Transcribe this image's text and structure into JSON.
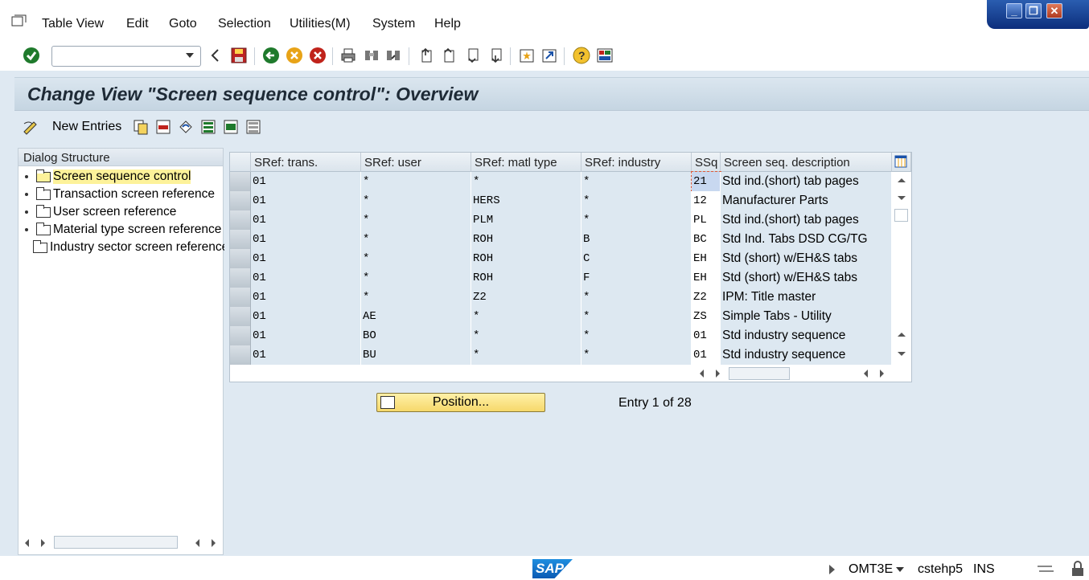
{
  "menubar": {
    "items": [
      "Table View",
      "Edit",
      "Goto",
      "Selection",
      "Utilities(M)",
      "System",
      "Help"
    ]
  },
  "toolbar": {
    "command_field_value": "",
    "icons": [
      "enter-icon",
      "back-arrow-icon",
      "save-icon",
      "back-icon",
      "exit-icon",
      "cancel-icon",
      "print-icon",
      "find-icon",
      "find-next-icon",
      "first-page-icon",
      "previous-page-icon",
      "next-page-icon",
      "last-page-icon",
      "create-session-icon",
      "shortcut-icon",
      "help-icon",
      "customize-layout-icon"
    ]
  },
  "title": "Change View \"Screen sequence control\": Overview",
  "app_toolbar": {
    "new_entries_label": "New Entries"
  },
  "dialog_structure": {
    "header": "Dialog Structure",
    "items": [
      {
        "label": "Screen sequence control",
        "selected": true
      },
      {
        "label": "Transaction screen reference",
        "selected": false
      },
      {
        "label": "User screen reference",
        "selected": false
      },
      {
        "label": "Material type screen reference",
        "selected": false
      },
      {
        "label": "Industry sector screen reference",
        "selected": false
      }
    ]
  },
  "table": {
    "columns": [
      "SRef: trans.",
      "SRef: user",
      "SRef: matl type",
      "SRef: industry",
      "SSq",
      "Screen seq. description"
    ],
    "rows": [
      [
        "01",
        "*",
        "*",
        "*",
        "21",
        "Std ind.(short) tab pages"
      ],
      [
        "01",
        "*",
        "HERS",
        "*",
        "12",
        "Manufacturer Parts"
      ],
      [
        "01",
        "*",
        "PLM",
        "*",
        "PL",
        "Std ind.(short) tab pages"
      ],
      [
        "01",
        "*",
        "ROH",
        "B",
        "BC",
        "Std Ind. Tabs DSD CG/TG"
      ],
      [
        "01",
        "*",
        "ROH",
        "C",
        "EH",
        "Std (short) w/EH&S tabs"
      ],
      [
        "01",
        "*",
        "ROH",
        "F",
        "EH",
        "Std (short) w/EH&S tabs"
      ],
      [
        "01",
        "*",
        "Z2",
        "*",
        "Z2",
        "IPM: Title master"
      ],
      [
        "01",
        "AE",
        "*",
        "*",
        "ZS",
        "Simple Tabs - Utility"
      ],
      [
        "01",
        "BO",
        "*",
        "*",
        "01",
        "Std industry sequence"
      ],
      [
        "01",
        "BU",
        "*",
        "*",
        "01",
        "Std industry sequence"
      ]
    ]
  },
  "position_button": "Position...",
  "entry_info": "Entry 1 of 28",
  "status_bar": {
    "transaction": "OMT3E",
    "server": "cstehp5",
    "mode": "INS",
    "logo": "SAP"
  }
}
